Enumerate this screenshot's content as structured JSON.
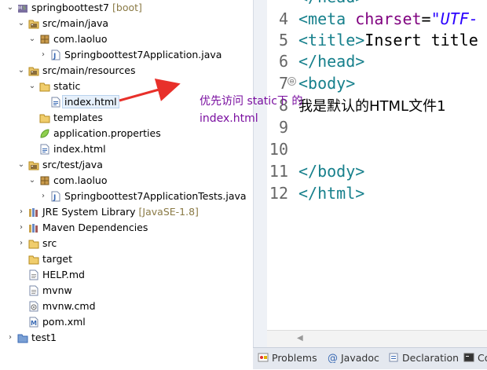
{
  "explorer": {
    "items": [
      {
        "label": "springboottest7",
        "decoration": "[boot]",
        "icon": "spring-project-icon",
        "twisty": "expanded"
      },
      {
        "label": "src/main/java",
        "icon": "source-folder-icon",
        "twisty": "expanded"
      },
      {
        "label": "com.laoluo",
        "icon": "package-icon",
        "twisty": "expanded"
      },
      {
        "label": "Springboottest7Application.java",
        "icon": "java-file-icon",
        "twisty": "collapsed"
      },
      {
        "label": "src/main/resources",
        "icon": "source-folder-icon",
        "twisty": "expanded"
      },
      {
        "label": "static",
        "icon": "folder-icon",
        "twisty": "expanded"
      },
      {
        "label": "index.html",
        "icon": "html-file-icon",
        "twisty": "none",
        "selected": true
      },
      {
        "label": "templates",
        "icon": "folder-icon",
        "twisty": "none"
      },
      {
        "label": "application.properties",
        "icon": "properties-file-icon",
        "twisty": "none"
      },
      {
        "label": "index.html",
        "icon": "html-file-icon",
        "twisty": "none"
      },
      {
        "label": "src/test/java",
        "icon": "source-folder-icon",
        "twisty": "expanded"
      },
      {
        "label": "com.laoluo",
        "icon": "package-icon",
        "twisty": "expanded"
      },
      {
        "label": "Springboottest7ApplicationTests.java",
        "icon": "java-file-icon",
        "twisty": "collapsed"
      },
      {
        "label": "JRE System Library",
        "decoration": "[JavaSE-1.8]",
        "icon": "library-icon",
        "twisty": "collapsed"
      },
      {
        "label": "Maven Dependencies",
        "icon": "library-icon",
        "twisty": "collapsed"
      },
      {
        "label": "src",
        "icon": "folder-icon",
        "twisty": "collapsed"
      },
      {
        "label": "target",
        "icon": "folder-icon",
        "twisty": "none"
      },
      {
        "label": "HELP.md",
        "icon": "text-file-icon",
        "twisty": "none"
      },
      {
        "label": "mvnw",
        "icon": "text-file-icon",
        "twisty": "none"
      },
      {
        "label": "mvnw.cmd",
        "icon": "cmd-file-icon",
        "twisty": "none"
      },
      {
        "label": "pom.xml",
        "icon": "xml-file-icon",
        "twisty": "none"
      },
      {
        "label": "test1",
        "icon": "project-icon",
        "twisty": "collapsed"
      }
    ]
  },
  "editor": {
    "lines": [
      {
        "num": "4",
        "segments": [
          {
            "t": "<meta ",
            "c": "tag"
          },
          {
            "t": "charset",
            "c": "attr"
          },
          {
            "t": "=",
            "c": "plain"
          },
          {
            "t": "\"UTF-",
            "c": "str"
          }
        ]
      },
      {
        "num": "5",
        "segments": [
          {
            "t": "<title>",
            "c": "tag"
          },
          {
            "t": "Insert title",
            "c": "plain"
          }
        ]
      },
      {
        "num": "6",
        "segments": [
          {
            "t": "</head>",
            "c": "tag"
          }
        ]
      },
      {
        "num": "7",
        "segments": [
          {
            "t": "<body>",
            "c": "tag"
          }
        ]
      },
      {
        "num": "8",
        "segments": [
          {
            "t": "我是默认的HTML文件1",
            "c": "cjk"
          }
        ]
      },
      {
        "num": "9",
        "segments": []
      },
      {
        "num": "10",
        "segments": []
      },
      {
        "num": "11",
        "segments": [
          {
            "t": "</body>",
            "c": "tag"
          }
        ]
      },
      {
        "num": "12",
        "segments": [
          {
            "t": "</html>",
            "c": "tag"
          }
        ]
      }
    ],
    "partial_top_line": "</head>"
  },
  "annotation": {
    "line1": "优先访问 static下 的",
    "line2": "index.html",
    "color": "#7a0fa0",
    "arrow_color": "#e8302a"
  },
  "bottom_tabs": [
    {
      "label": "Problems",
      "icon": "problems-icon"
    },
    {
      "label": "Javadoc",
      "icon": "javadoc-icon"
    },
    {
      "label": "Declaration",
      "icon": "declaration-icon"
    },
    {
      "label": "Co",
      "icon": "console-icon"
    }
  ],
  "colors": {
    "tag": "#17808c",
    "attribute": "#7f007f",
    "string": "#2a00ff",
    "selection": "#e6f0fb"
  }
}
